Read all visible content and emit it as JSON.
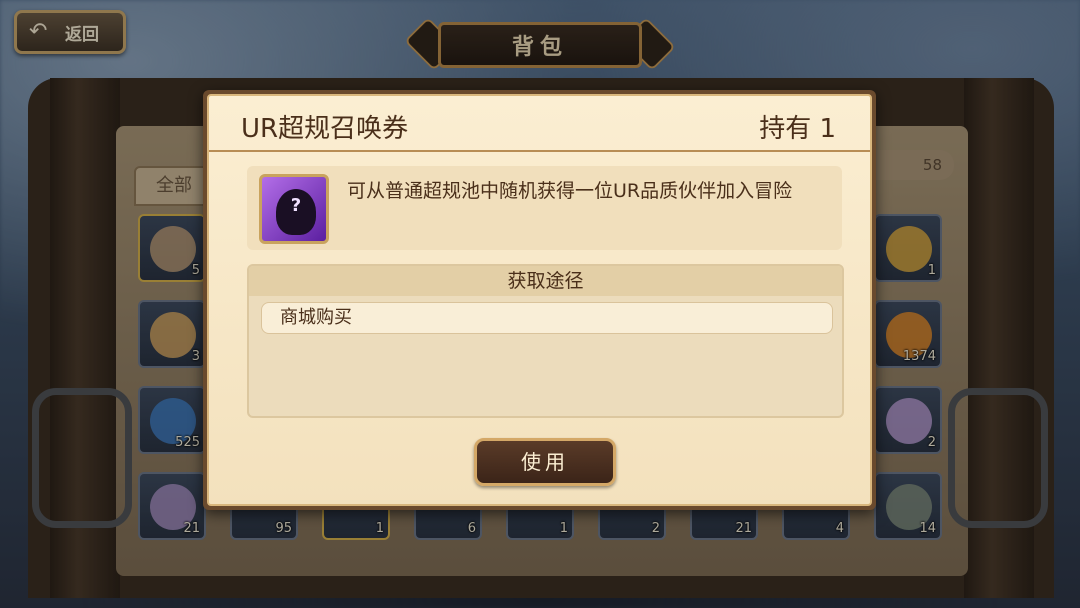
{
  "header": {
    "back_label": "返回",
    "title": "背包"
  },
  "bag": {
    "tab_all": "全部",
    "capacity_count": "58",
    "slot_counts_left": [
      "5",
      "3",
      "525",
      "21"
    ],
    "slot_counts_right": [
      "1",
      "1374",
      "2",
      "14"
    ],
    "slot_counts_bottom": [
      "95",
      "1",
      "6",
      "1",
      "2",
      "21",
      "4"
    ]
  },
  "dialog": {
    "item_name": "UR超规召唤券",
    "hold_label": "持有 1",
    "description": "可从普通超规池中随机获得一位UR品质伙伴加入冒险",
    "icon_glyph": "?",
    "source_heading": "获取途径",
    "sources": [
      "商城购买"
    ],
    "use_button": "使用"
  },
  "colors": {
    "dialog_bg": "#f3e1bd",
    "text_brown": "#4a2f1a",
    "gold_border": "#d4a867",
    "item_icon_purple": "#7a36c4"
  }
}
